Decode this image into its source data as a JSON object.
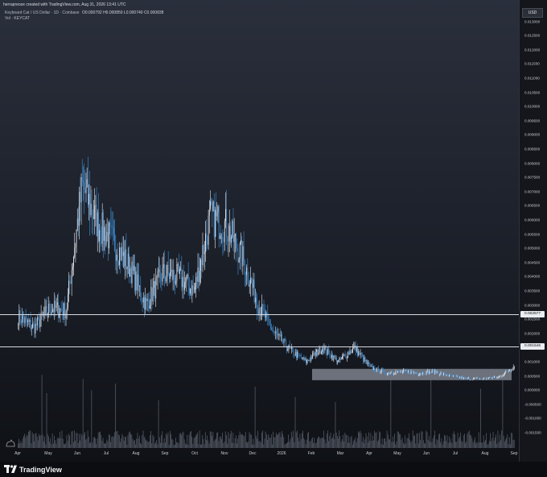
{
  "header": {
    "created_line": "herrapreoze created with TradingView.com, Aug 31, 2026 13:41 UTC"
  },
  "legend": {
    "symbol": "Keyboard Cat / US Dollar · 1D · Coinbase",
    "ohlc": "O0.000792  H0.000850  L0.000740  C0.000838",
    "volume_label": "Vol · KEYCAT"
  },
  "price_axis": {
    "currency": "USD",
    "ticks": [
      "0.013000",
      "0.012500",
      "0.012000",
      "0.011500",
      "0.011000",
      "0.010500",
      "0.010000",
      "0.009500",
      "0.009000",
      "0.008500",
      "0.008000",
      "0.007500",
      "0.007000",
      "0.006500",
      "0.006000",
      "0.005500",
      "0.005000",
      "0.004500",
      "0.004000",
      "0.003500",
      "0.003000",
      "0.002500",
      "0.002000",
      "0.001500",
      "0.001000",
      "0.000500",
      "0.000000",
      "-0.000500",
      "-0.001000",
      "-0.001500"
    ],
    "marked_levels": [
      "0.002677",
      "0.001546"
    ]
  },
  "time_axis": {
    "ticks": [
      "Apr",
      "May",
      "Jun",
      "Jul",
      "Aug",
      "Sep",
      "Oct",
      "Nov",
      "Dec",
      "2026",
      "Feb",
      "Mar",
      "Apr",
      "May",
      "Jun",
      "Jul",
      "Aug",
      "Sep"
    ]
  },
  "branding": {
    "name": "TradingView"
  },
  "colors": {
    "up": "#e6e8ee",
    "down": "#3f8fd6",
    "volume": "#6b7482",
    "line": "#d7dae0",
    "box": "#8a909b"
  },
  "chart_data": {
    "type": "candlestick",
    "symbol": "KEYCAT/USD",
    "currency": "USD",
    "ylim": [
      -0.0017,
      0.0133
    ],
    "approx_close_path": [
      {
        "x": "Apr",
        "y": 0.0026
      },
      {
        "x": "Apr",
        "y": 0.0022
      },
      {
        "x": "Apr",
        "y": 0.0029
      },
      {
        "x": "May",
        "y": 0.0028
      },
      {
        "x": "May",
        "y": 0.0072
      },
      {
        "x": "May",
        "y": 0.0058
      },
      {
        "x": "Jun",
        "y": 0.0052
      },
      {
        "x": "Jun",
        "y": 0.0043
      },
      {
        "x": "Jul",
        "y": 0.003
      },
      {
        "x": "Jul",
        "y": 0.0041
      },
      {
        "x": "Aug",
        "y": 0.004
      },
      {
        "x": "Aug",
        "y": 0.0035
      },
      {
        "x": "Aug",
        "y": 0.0061
      },
      {
        "x": "Sep",
        "y": 0.0058
      },
      {
        "x": "Sep",
        "y": 0.0047
      },
      {
        "x": "Oct",
        "y": 0.003
      },
      {
        "x": "Oct",
        "y": 0.002
      },
      {
        "x": "Nov",
        "y": 0.0014
      },
      {
        "x": "Nov",
        "y": 0.001
      },
      {
        "x": "Dec",
        "y": 0.0015
      },
      {
        "x": "Dec",
        "y": 0.001
      },
      {
        "x": "2026",
        "y": 0.0015
      },
      {
        "x": "2026",
        "y": 0.0008
      },
      {
        "x": "Feb",
        "y": 0.0006
      },
      {
        "x": "Mar",
        "y": 0.00065
      },
      {
        "x": "Apr",
        "y": 0.0006
      },
      {
        "x": "May",
        "y": 0.00065
      },
      {
        "x": "May",
        "y": 0.0005
      },
      {
        "x": "Jun",
        "y": 0.0004
      },
      {
        "x": "Jul",
        "y": 0.0004
      },
      {
        "x": "Aug",
        "y": 0.00045
      },
      {
        "x": "Sep",
        "y": 0.00084
      }
    ],
    "horizontal_levels": [
      0.002677,
      0.001546
    ],
    "range_box": {
      "from": "Feb",
      "to": "Sep",
      "low": 0.00035,
      "high": 0.00075
    },
    "grid": false
  }
}
